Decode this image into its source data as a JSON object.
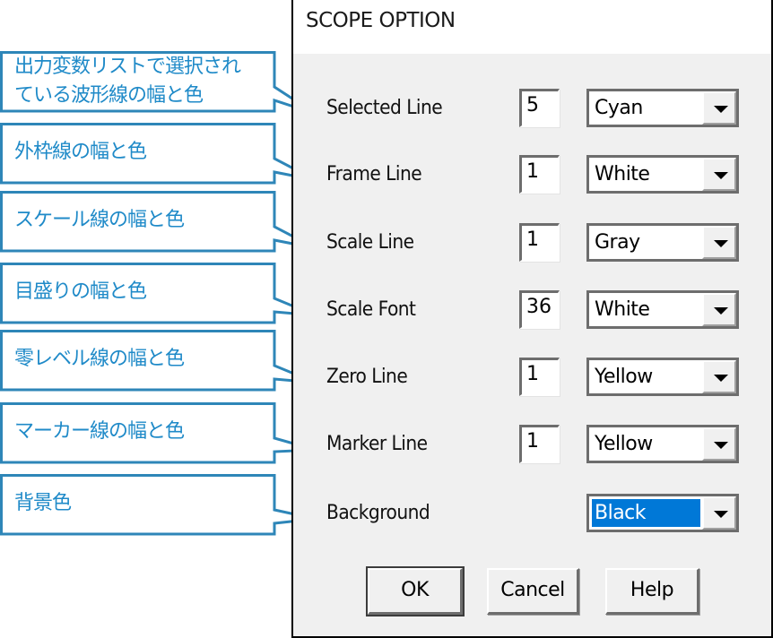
{
  "dialog": {
    "title": "SCOPE OPTION",
    "rows": [
      {
        "label": "Selected Line",
        "width": "5",
        "color": "Cyan",
        "selected": false
      },
      {
        "label": "Frame Line",
        "width": "1",
        "color": "White",
        "selected": false
      },
      {
        "label": "Scale Line",
        "width": "1",
        "color": "Gray",
        "selected": false
      },
      {
        "label": "Scale Font",
        "width": "36",
        "color": "White",
        "selected": false
      },
      {
        "label": "Zero Line",
        "width": "1",
        "color": "Yellow",
        "selected": false
      },
      {
        "label": "Marker Line",
        "width": "1",
        "color": "Yellow",
        "selected": false
      },
      {
        "label": "Background",
        "width": null,
        "color": "Black",
        "selected": true
      }
    ],
    "buttons": {
      "ok": "OK",
      "cancel": "Cancel",
      "help": "Help"
    }
  },
  "callouts": [
    {
      "lines": [
        "出力変数リストで選択され",
        "ている波形線の幅と色"
      ]
    },
    {
      "lines": [
        "外枠線の幅と色"
      ]
    },
    {
      "lines": [
        "スケール線の幅と色"
      ]
    },
    {
      "lines": [
        "目盛りの幅と色"
      ]
    },
    {
      "lines": [
        "零レベル線の幅と色"
      ]
    },
    {
      "lines": [
        "マーカー線の幅と色"
      ]
    },
    {
      "lines": [
        "背景色"
      ]
    }
  ],
  "colors": {
    "callout_border": "#2e86b8",
    "callout_text": "#1f8ac8",
    "selection": "#0078d7",
    "dialog_bg": "#f0f0f0"
  }
}
